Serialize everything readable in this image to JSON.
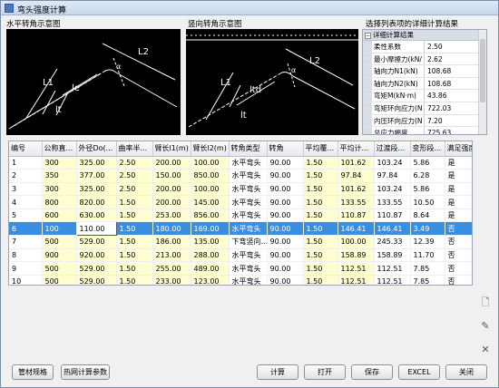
{
  "window": {
    "title": "弯头强度计算"
  },
  "captions": {
    "horizontal": "水平转角示意图",
    "vertical": "竖向转角示意图",
    "detail": "选择列表项的详细计算结果"
  },
  "diagram_labels": {
    "horizontal": {
      "l2": "L2",
      "l1": "L1",
      "le": "le",
      "lt": "lt",
      "alpha": "α"
    },
    "vertical": {
      "l2": "L2",
      "l1": "L1",
      "ltd": "ltd",
      "lt": "lt",
      "alpha": "α"
    }
  },
  "detail": {
    "group_label": "详细计算结果",
    "rows": [
      {
        "key": "柔性系数",
        "value": "2.50"
      },
      {
        "key": "最小摩擦力(kN/",
        "value": "2.62"
      },
      {
        "key": "轴向力N1(kN)",
        "value": "108.68"
      },
      {
        "key": "轴向力N2(kN)",
        "value": "108.68"
      },
      {
        "key": "弯矩M(kN·m)",
        "value": "43.86"
      },
      {
        "key": "弯矩环向应力(N",
        "value": "722.03"
      },
      {
        "key": "内压环向应力(N",
        "value": "7.20"
      },
      {
        "key": "总应力幅度",
        "value": "725.63"
      }
    ]
  },
  "table": {
    "columns": [
      "编号",
      "公称直...",
      "外径Do(...",
      "曲率半...",
      "臂长l1(m)",
      "臂长l2(m)",
      "转角类型",
      "转角",
      "平均覆...",
      "平均计...",
      "过渡段...",
      "变形段...",
      "满足强度"
    ],
    "rows": [
      [
        "1",
        "300",
        "325.00",
        "2.50",
        "200.00",
        "100.00",
        "水平弯头",
        "90.00",
        "1.50",
        "101.62",
        "103.24",
        "5.86",
        "是"
      ],
      [
        "2",
        "350",
        "377.00",
        "2.50",
        "150.00",
        "850.00",
        "水平弯头",
        "90.00",
        "1.50",
        "97.84",
        "97.84",
        "6.28",
        "是"
      ],
      [
        "3",
        "300",
        "325.00",
        "2.50",
        "200.00",
        "100.00",
        "水平弯头",
        "90.00",
        "1.50",
        "101.62",
        "103.24",
        "5.86",
        "是"
      ],
      [
        "4",
        "800",
        "820.00",
        "1.50",
        "200.00",
        "145.00",
        "水平弯头",
        "90.00",
        "1.50",
        "133.55",
        "133.55",
        "10.50",
        "是"
      ],
      [
        "5",
        "600",
        "630.00",
        "1.50",
        "253.00",
        "856.00",
        "水平弯头",
        "90.00",
        "1.50",
        "110.87",
        "110.87",
        "8.64",
        "是"
      ],
      [
        "6",
        "100",
        "110.00",
        "1.50",
        "180.00",
        "169.00",
        "水平弯头",
        "90.00",
        "1.50",
        "146.41",
        "146.41",
        "3.49",
        "否"
      ],
      [
        "7",
        "500",
        "529.00",
        "1.50",
        "186.00",
        "135.00",
        "下弯竖向...",
        "90.00",
        "1.50",
        "100.00",
        "245.33",
        "12.39",
        "否"
      ],
      [
        "8",
        "900",
        "920.00",
        "1.50",
        "213.00",
        "288.00",
        "水平弯头",
        "90.00",
        "1.50",
        "158.89",
        "158.89",
        "11.70",
        "否"
      ],
      [
        "9",
        "500",
        "529.00",
        "1.50",
        "255.00",
        "489.00",
        "水平弯头",
        "90.00",
        "1.50",
        "112.51",
        "112.51",
        "7.85",
        "否"
      ],
      [
        "10",
        "500",
        "529.00",
        "1.50",
        "233.00",
        "123.00",
        "水平弯头",
        "90.00",
        "1.50",
        "112.51",
        "112.51",
        "7.85",
        "否"
      ]
    ],
    "selected_index": 5
  },
  "side_icons": [
    "new-row-icon",
    "edit-row-icon",
    "delete-row-icon"
  ],
  "buttons": {
    "pipe_spec": "管材规格",
    "network_params": "热网计算参数",
    "calculate": "计算",
    "open": "打开",
    "save": "保存",
    "excel": "EXCEL",
    "close": "关闭"
  }
}
